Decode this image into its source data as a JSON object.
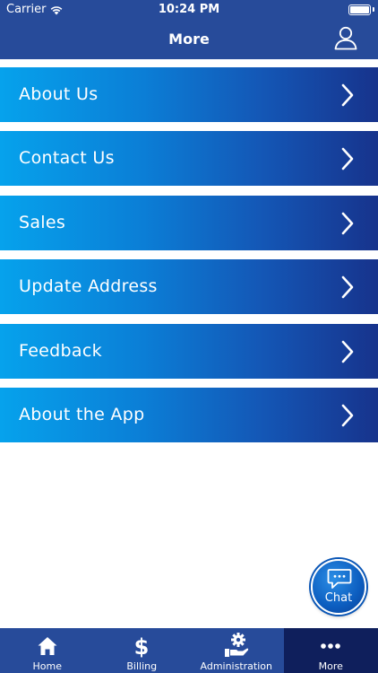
{
  "status_bar": {
    "carrier": "Carrier",
    "time": "10:24 PM"
  },
  "header": {
    "title": "More",
    "profile_icon": "user-icon"
  },
  "menu": {
    "items": [
      {
        "label": "About Us"
      },
      {
        "label": "Contact Us"
      },
      {
        "label": "Sales"
      },
      {
        "label": "Update Address"
      },
      {
        "label": "Feedback"
      },
      {
        "label": "About the App"
      }
    ],
    "chevron_icon": "chevron-right-icon"
  },
  "chat": {
    "label": "Chat",
    "icon": "chat-bubble-icon"
  },
  "tabbar": {
    "tabs": [
      {
        "label": "Home",
        "icon": "home-icon"
      },
      {
        "label": "Billing",
        "icon": "dollar-icon"
      },
      {
        "label": "Administration",
        "icon": "gear-hand-icon"
      },
      {
        "label": "More",
        "icon": "more-dots-icon",
        "active": true
      }
    ]
  },
  "colors": {
    "header_bg": "#274b9a",
    "tab_active_bg": "#0f1f5c",
    "menu_gradient_start": "#06a2ec",
    "menu_gradient_end": "#17338c"
  }
}
